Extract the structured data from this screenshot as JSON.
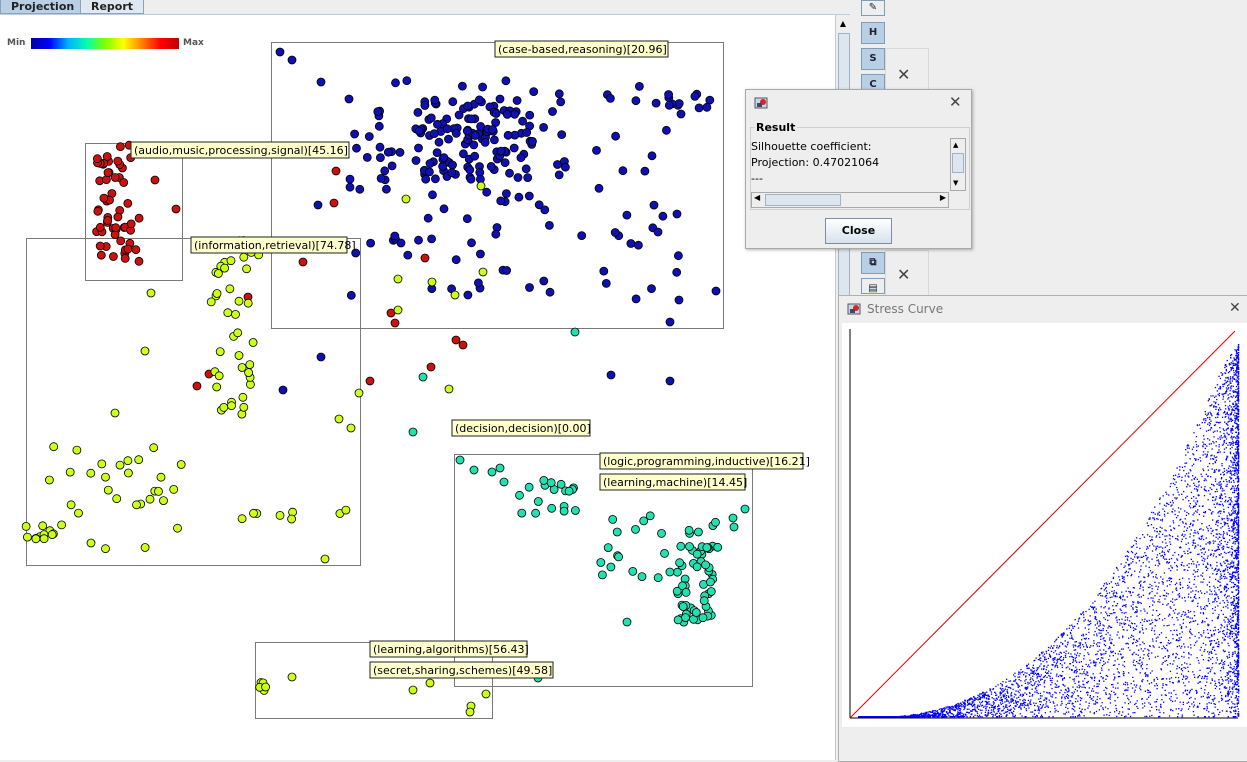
{
  "tabs": [
    {
      "label": "Projection",
      "active": true
    },
    {
      "label": "Report",
      "active": false
    }
  ],
  "legend": {
    "min_label": "Min",
    "max_label": "Max"
  },
  "cluster_labels": [
    {
      "text": "(case-based,reasoning)[20.96]"
    },
    {
      "text": "(audio,music,processing,signal)[45.16]"
    },
    {
      "text": "(information,retrieval)[74.78]"
    },
    {
      "text": "(decision,decision)[0.00]"
    },
    {
      "text": "(logic,programming,inductive)[16.21]"
    },
    {
      "text": "(learning,machine)[14.45]"
    },
    {
      "text": "(learning,algorithms)[56.43]"
    },
    {
      "text": "(secret,sharing,schemes)[49.58]"
    }
  ],
  "toolbar": {
    "buttons": [
      "H",
      "S",
      "C"
    ]
  },
  "result_dialog": {
    "section_title": "Result",
    "lines": [
      "Silhouette coefficient:",
      "Projection: 0.47021064",
      "---"
    ],
    "close_label": "Close"
  },
  "stress_window": {
    "title": "Stress Curve"
  },
  "colors": {
    "blue": "#1010b0",
    "red": "#cc1111",
    "yellow": "#ccff1a",
    "teal": "#22e0b0",
    "selection_border": "#7a7a7a",
    "stress_points": "#0000ff",
    "stress_line": "#dd0000"
  }
}
